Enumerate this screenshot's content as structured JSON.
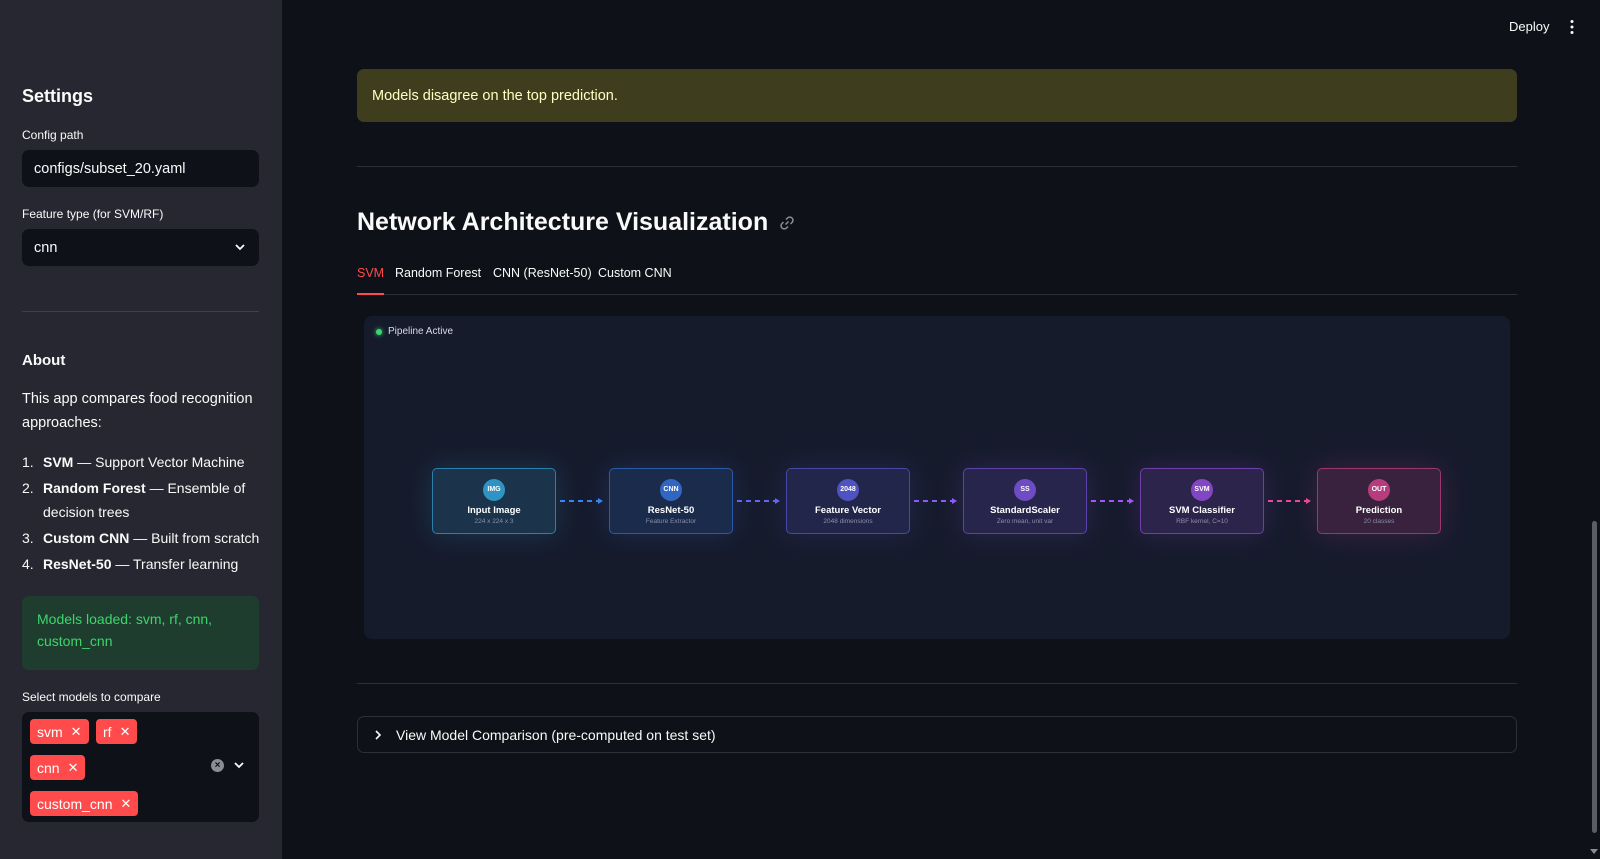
{
  "sidebar": {
    "title": "Settings",
    "config_path_label": "Config path",
    "config_path_value": "configs/subset_20.yaml",
    "feature_type_label": "Feature type (for SVM/RF)",
    "feature_type_value": "cnn",
    "about_title": "About",
    "about_desc": "This app compares food recognition approaches:",
    "approaches": [
      {
        "num": "1.",
        "name": "SVM",
        "desc": " — Support Vector Machine"
      },
      {
        "num": "2.",
        "name": "Random Forest",
        "desc": " — Ensemble of decision trees"
      },
      {
        "num": "3.",
        "name": "Custom CNN",
        "desc": " — Built from scratch"
      },
      {
        "num": "4.",
        "name": "ResNet-50",
        "desc": " — Transfer learning"
      }
    ],
    "models_loaded": "Models loaded: svm, rf, cnn, custom_cnn",
    "select_models_label": "Select models to compare",
    "selected_models": [
      "svm",
      "rf",
      "cnn",
      "custom_cnn"
    ]
  },
  "header": {
    "deploy_label": "Deploy",
    "menu_icon": "kebab-menu-icon"
  },
  "main": {
    "warning_text": "Models disagree on the top prediction.",
    "section_title": "Network Architecture Visualization",
    "link_icon": "link-icon",
    "tabs": [
      {
        "label": "SVM",
        "active": true
      },
      {
        "label": "Random Forest",
        "active": false
      },
      {
        "label": "CNN (ResNet-50)",
        "active": false
      },
      {
        "label": "Custom CNN",
        "active": false
      }
    ],
    "pipeline_status": "Pipeline Active",
    "pipeline_nodes": [
      {
        "badge": "IMG",
        "title": "Input Image",
        "sub": "224 x 224 x 3",
        "color": "#38bdf8"
      },
      {
        "badge": "CNN",
        "title": "ResNet-50",
        "sub": "Feature Extractor",
        "color": "#3b82f6"
      },
      {
        "badge": "2048",
        "title": "Feature Vector",
        "sub": "2048 dimensions",
        "color": "#6366f1"
      },
      {
        "badge": "SS",
        "title": "StandardScaler",
        "sub": "Zero mean, unit var",
        "color": "#8b5cf6"
      },
      {
        "badge": "SVM",
        "title": "SVM Classifier",
        "sub": "RBF kernel, C=10",
        "color": "#a855f7"
      },
      {
        "badge": "OUT",
        "title": "Prediction",
        "sub": "20 classes",
        "color": "#ec4899"
      }
    ],
    "expander_label": "View Model Comparison (pre-computed on test set)"
  },
  "colors": {
    "accent": "#ff4b4b",
    "success_text": "#3dd56d",
    "warning_bg": "#3e3e1f"
  }
}
